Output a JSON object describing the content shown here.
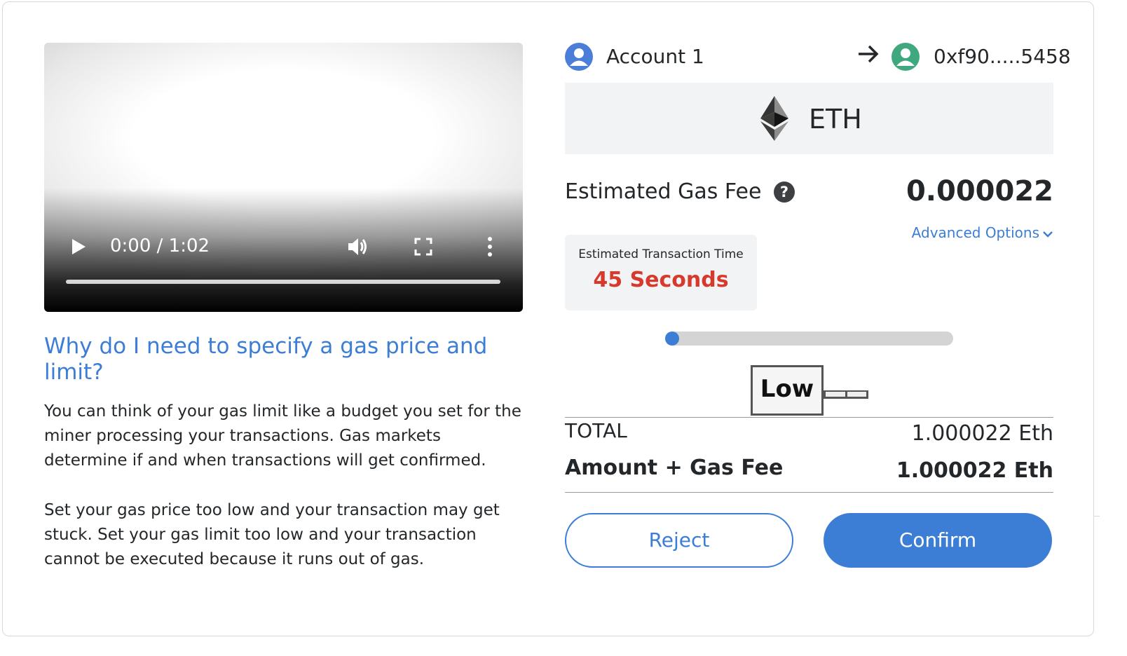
{
  "video": {
    "time": "0:00 / 1:02",
    "progress": 0,
    "icons": [
      "play-icon",
      "volume-icon",
      "fullscreen-icon",
      "more-options-icon"
    ]
  },
  "help": {
    "title": "Why do I need to specify a gas price and limit?",
    "paragraph1": "You can think of your gas limit like a budget you set for the miner processing your transactions. Gas markets determine if and when transactions will get confirmed.",
    "paragraph2": "Set your gas price too low and your transaction may get stuck. Set your gas limit too low and your transaction cannot be executed because it runs out of gas."
  },
  "transaction": {
    "from_account": "Account 1",
    "to_address": "0xf90.....5458",
    "token": "ETH",
    "gas_fee_label": "Estimated Gas Fee",
    "gas_fee_value": "0.000022",
    "advanced_options": "Advanced Options",
    "time_label": "Estimated Transaction Time",
    "time_value": "45 Seconds",
    "gas_speed_label": "Low",
    "gas_speed_level": 0,
    "total_label": "TOTAL",
    "total_value": "1.000022 Eth",
    "sum_label": "Amount + Gas Fee",
    "sum_value": "1.000022 Eth"
  },
  "buttons": {
    "reject": "Reject",
    "confirm": "Confirm"
  },
  "colors": {
    "accent": "#3c7ed6",
    "time_value": "#d73a2c",
    "from_avatar": "#4a7ed8",
    "to_avatar": "#3fa87e"
  }
}
